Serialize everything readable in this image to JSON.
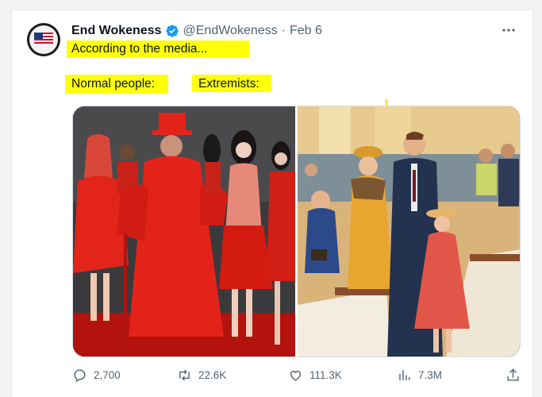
{
  "post": {
    "author_name": "End Wokeness",
    "handle": "@EndWokeness",
    "separator": "·",
    "date": "Feb 6",
    "line1": "According to the media...",
    "label_left": "Normal people:",
    "label_right": "Extremists:"
  },
  "actions": {
    "replies": "2,700",
    "reposts": "22.6K",
    "likes": "111.3K",
    "views": "7.3M"
  },
  "colors": {
    "highlight": "#ffff00",
    "verified": "#1d9bf0",
    "muted": "#536471"
  },
  "icons": [
    "verified-badge-icon",
    "more-icon",
    "reply-icon",
    "repost-icon",
    "like-icon",
    "views-icon",
    "share-icon"
  ]
}
